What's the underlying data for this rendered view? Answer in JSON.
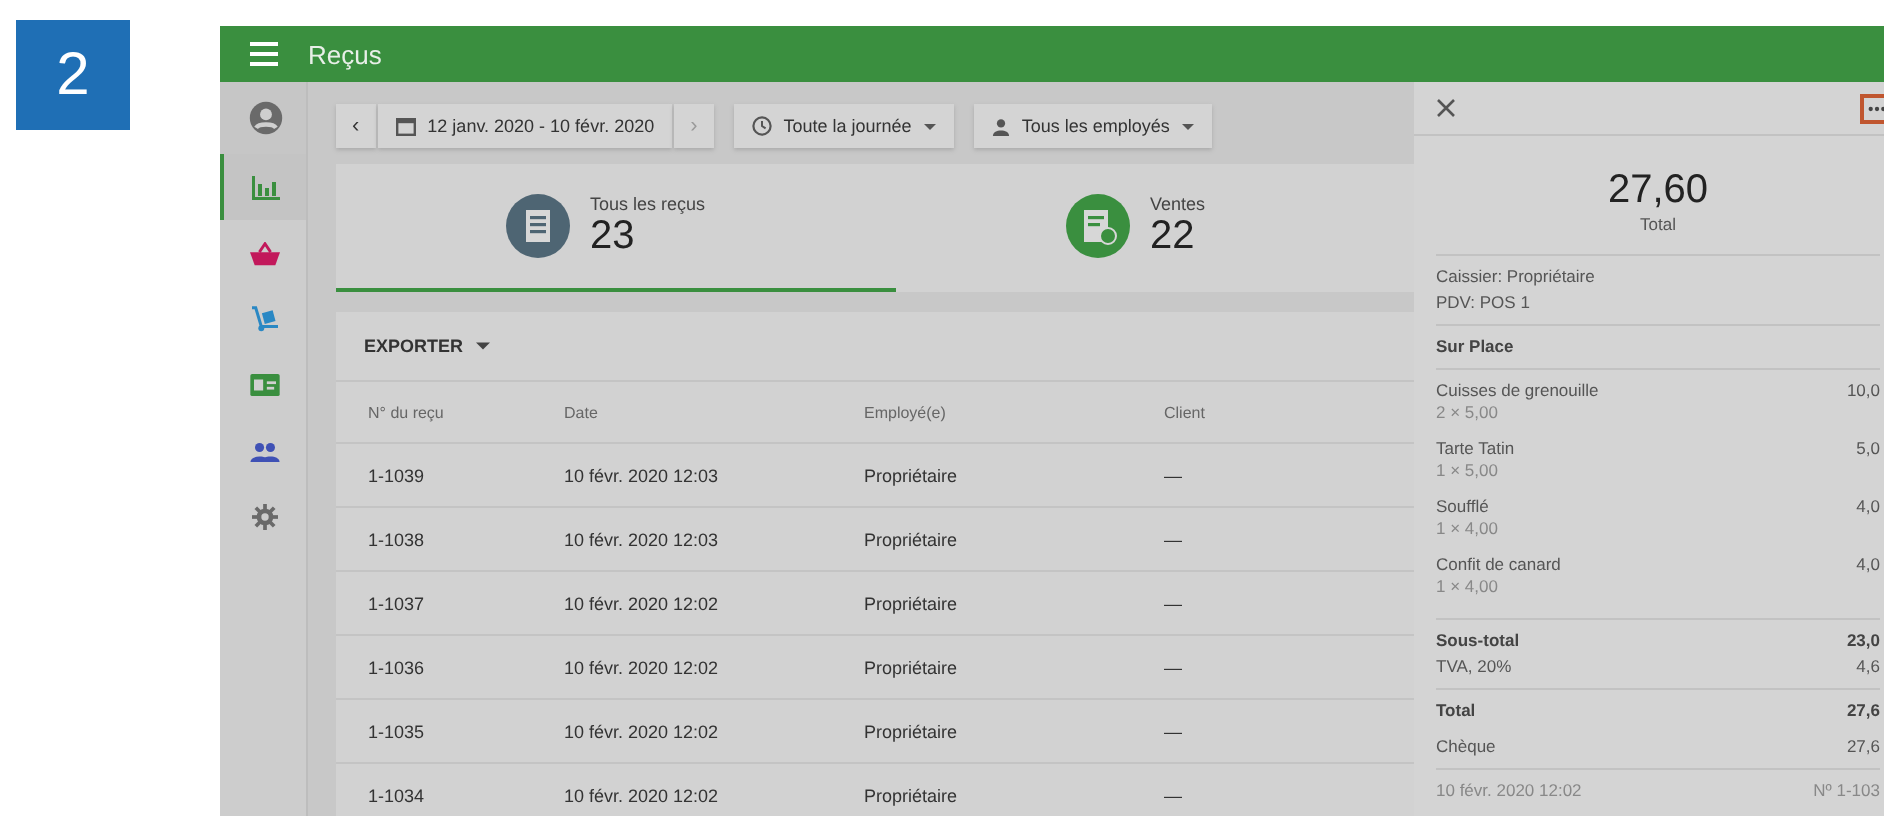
{
  "step_badge": "2",
  "header": {
    "title": "Reçus"
  },
  "sidebar": {
    "items": [
      {
        "kind": "user",
        "selected": false
      },
      {
        "kind": "chart",
        "selected": true
      },
      {
        "kind": "basket",
        "selected": false
      },
      {
        "kind": "truck",
        "selected": false
      },
      {
        "kind": "card",
        "selected": false
      },
      {
        "kind": "people",
        "selected": false
      },
      {
        "kind": "gear",
        "selected": false
      }
    ]
  },
  "filters": {
    "prev": "‹",
    "date_range": "12 janv. 2020 - 10 févr. 2020",
    "next": "›",
    "time": "Toute la journée",
    "employees": "Tous les employés"
  },
  "summary_tabs": [
    {
      "kind": "receipts",
      "label": "Tous les reçus",
      "count": "23",
      "selected": true
    },
    {
      "kind": "sales",
      "label": "Ventes",
      "count": "22",
      "selected": false
    }
  ],
  "export_button": "EXPORTER",
  "table": {
    "columns": [
      "N° du reçu",
      "Date",
      "Employé(e)",
      "Client"
    ],
    "rows": [
      [
        "1-1039",
        "10 févr. 2020 12:03",
        "Propriétaire",
        "—"
      ],
      [
        "1-1038",
        "10 févr. 2020 12:03",
        "Propriétaire",
        "—"
      ],
      [
        "1-1037",
        "10 févr. 2020 12:02",
        "Propriétaire",
        "—"
      ],
      [
        "1-1036",
        "10 févr. 2020 12:02",
        "Propriétaire",
        "—"
      ],
      [
        "1-1035",
        "10 févr. 2020 12:02",
        "Propriétaire",
        "—"
      ],
      [
        "1-1034",
        "10 févr. 2020 12:02",
        "Propriétaire",
        "—"
      ]
    ]
  },
  "receipt_panel": {
    "total": "27,60",
    "total_label": "Total",
    "cashier": "Caissier: Propriétaire",
    "pos": "PDV: POS 1",
    "dining": "Sur Place",
    "items": [
      {
        "name": "Cuisses de grenouille",
        "qty": "2 × 5,00",
        "amount": "10,0"
      },
      {
        "name": "Tarte Tatin",
        "qty": "1 × 5,00",
        "amount": "5,0"
      },
      {
        "name": "Soufflé",
        "qty": "1 × 4,00",
        "amount": "4,0"
      },
      {
        "name": "Confit de canard",
        "qty": "1 × 4,00",
        "amount": "4,0"
      }
    ],
    "subtotal_label": "Sous-total",
    "subtotal": "23,0",
    "tax_label": "TVA, 20%",
    "tax": "4,6",
    "grand_label": "Total",
    "grand": "27,6",
    "payment_label": "Chèque",
    "payment": "27,6",
    "date": "10 févr. 2020 12:02",
    "number": "Nº 1-103"
  }
}
